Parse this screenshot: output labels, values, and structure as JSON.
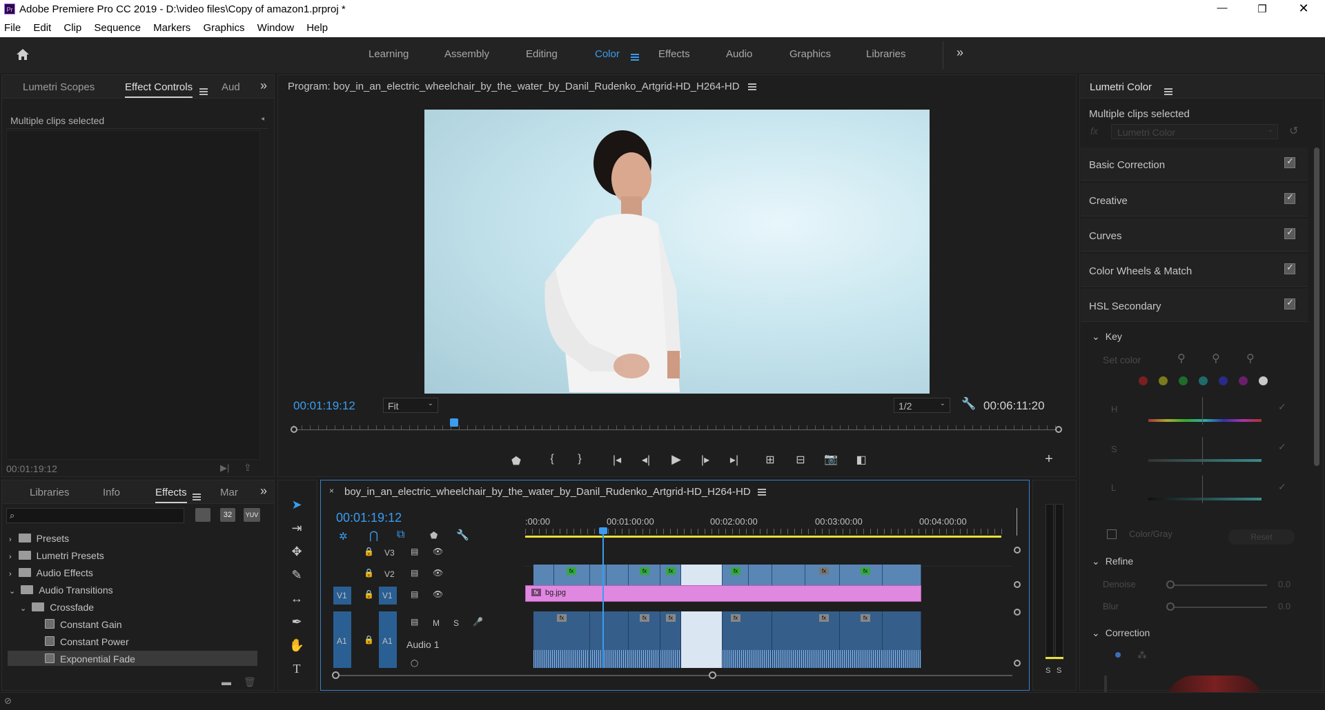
{
  "window": {
    "title": "Adobe Premiere Pro CC 2019 - D:\\video files\\Copy of amazon1.prproj *",
    "app_icon": "Pr"
  },
  "menu": [
    "File",
    "Edit",
    "Clip",
    "Sequence",
    "Markers",
    "Graphics",
    "Window",
    "Help"
  ],
  "workspaces": [
    "Learning",
    "Assembly",
    "Editing",
    "Color",
    "Effects",
    "Audio",
    "Graphics",
    "Libraries"
  ],
  "active_workspace": "Color",
  "top_left_panel": {
    "tabs": [
      "Lumetri Scopes",
      "Effect Controls",
      "Aud"
    ],
    "message": "Multiple clips selected",
    "timecode": "00:01:19:12"
  },
  "program": {
    "title": "Program: boy_in_an_electric_wheelchair_by_the_water_by_Danil_Rudenko_Artgrid-HD_H264-HD",
    "timecode": "00:01:19:12",
    "fit": "Fit",
    "resolution": "1/2",
    "duration": "00:06:11:20",
    "playhead_fraction": 0.21
  },
  "effects_panel": {
    "tabs": [
      "Libraries",
      "Info",
      "Effects",
      "Mar"
    ],
    "items": [
      {
        "label": "Presets",
        "level": 0,
        "expanded": false
      },
      {
        "label": "Lumetri Presets",
        "level": 0,
        "expanded": false
      },
      {
        "label": "Audio Effects",
        "level": 0,
        "expanded": false
      },
      {
        "label": "Audio Transitions",
        "level": 0,
        "expanded": true
      },
      {
        "label": "Crossfade",
        "level": 1,
        "expanded": true
      },
      {
        "label": "Constant Gain",
        "level": 2
      },
      {
        "label": "Constant Power",
        "level": 2
      },
      {
        "label": "Exponential Fade",
        "level": 2,
        "selected": true
      }
    ],
    "badges": [
      "32",
      "YUV"
    ]
  },
  "timeline": {
    "sequence": "boy_in_an_electric_wheelchair_by_the_water_by_Danil_Rudenko_Artgrid-HD_H264-HD",
    "timecode": "00:01:19:12",
    "ruler": [
      ":00:00",
      "00:01:00:00",
      "00:02:00:00",
      "00:03:00:00",
      "00:04:00:00"
    ],
    "tracks": {
      "v3": "V3",
      "v2": "V2",
      "v1": "V1",
      "a1": "A1",
      "audio_name": "Audio 1",
      "m": "M",
      "s": "S"
    },
    "v1_clip": "bg.jpg"
  },
  "lumetri": {
    "title": "Lumetri Color",
    "message": "Multiple clips selected",
    "effect_select": "Lumetri Color",
    "sections": [
      "Basic Correction",
      "Creative",
      "Curves",
      "Color Wheels & Match",
      "HSL Secondary"
    ],
    "key": "Key",
    "set_color": "Set color",
    "hsl": [
      "H",
      "S",
      "L"
    ],
    "color_gray": "Color/Gray",
    "reset": "Reset",
    "refine": "Refine",
    "denoise": "Denoise",
    "denoise_value": "0.0",
    "blur": "Blur",
    "blur_value": "0.0",
    "correction": "Correction",
    "swatch_colors": [
      "#7a1f1f",
      "#7a7a1f",
      "#1f6b2a",
      "#1f6b6b",
      "#2a2a8a",
      "#6b1f6b",
      "#c8c8c8"
    ]
  },
  "audio_meter": {
    "s_left": "S",
    "s_right": "S"
  }
}
